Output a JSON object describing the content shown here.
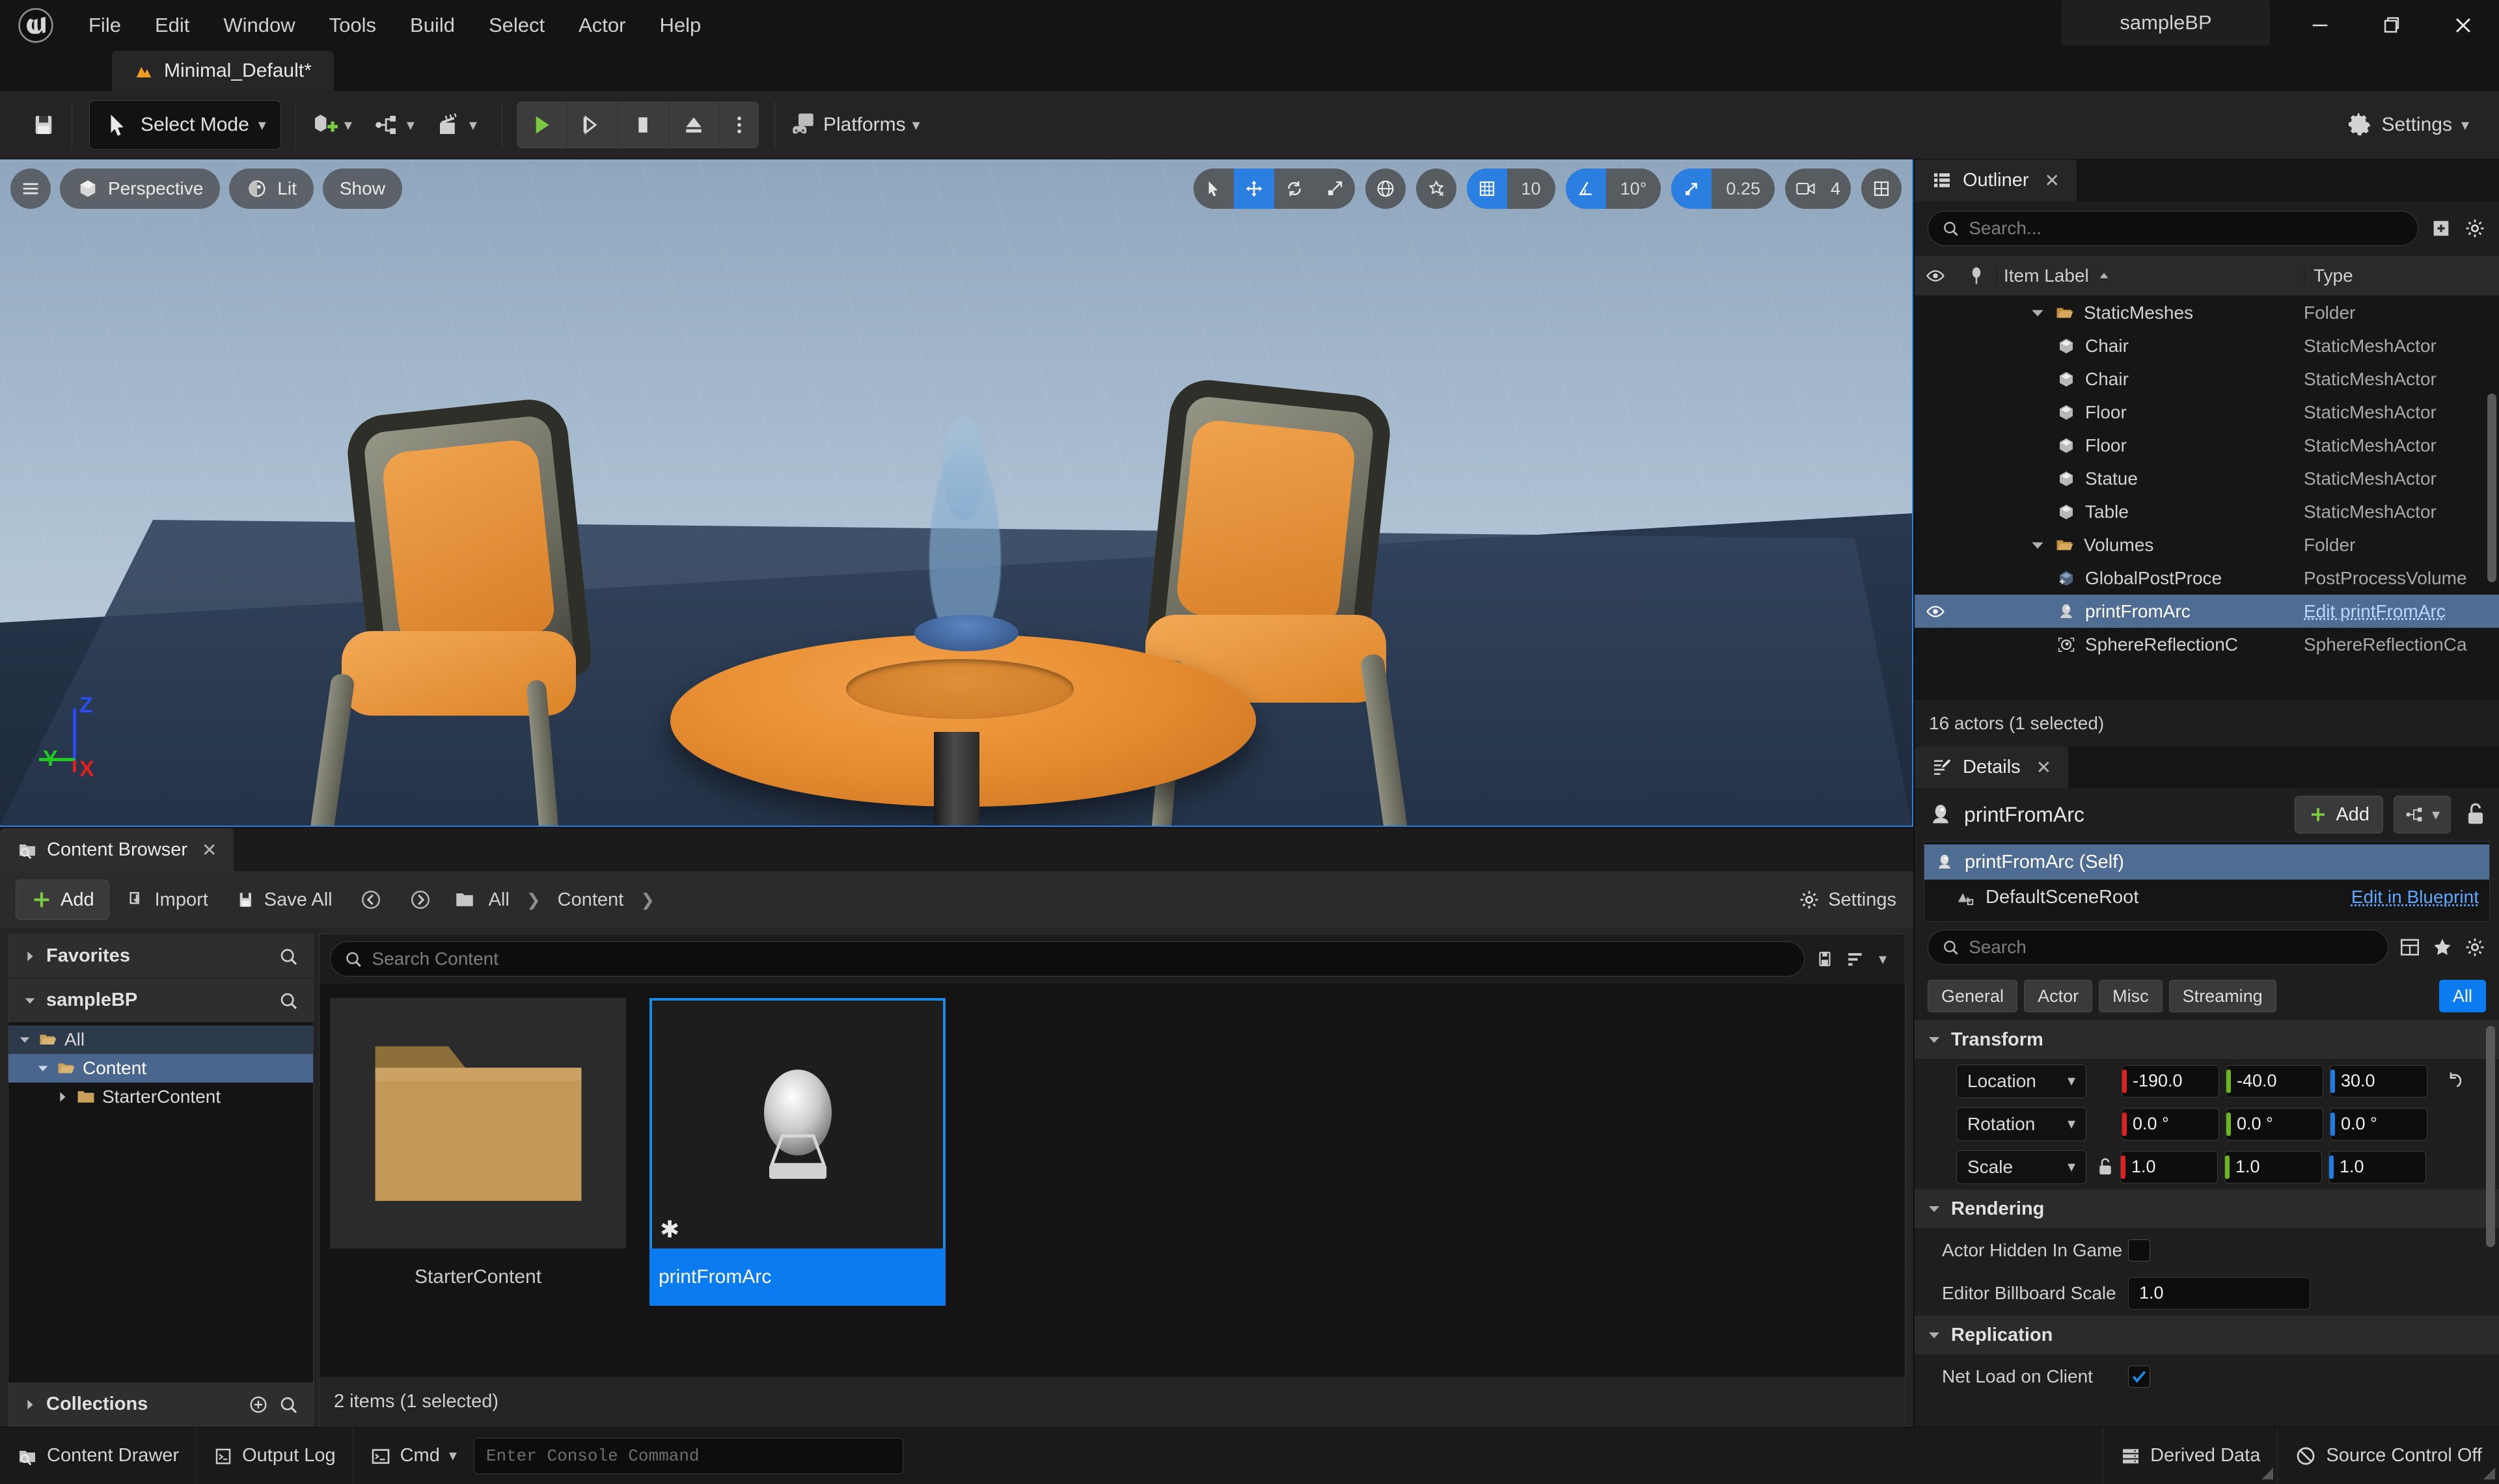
{
  "window": {
    "project_title": "sampleBP",
    "minimize": "minimize-icon",
    "maximize": "maximize-icon",
    "close": "close-icon"
  },
  "menubar": {
    "items": [
      "File",
      "Edit",
      "Window",
      "Tools",
      "Build",
      "Select",
      "Actor",
      "Help"
    ]
  },
  "level_tab": {
    "label": "Minimal_Default*"
  },
  "toolbar": {
    "save_icon": "save-icon",
    "select_mode": "Select Mode",
    "create_icon": "add-actor-icon",
    "blueprints_icon": "blueprints-icon",
    "cinematics_icon": "cinematics-icon",
    "play": "play-icon",
    "step": "skip-icon",
    "stop": "stop-icon",
    "eject": "eject-icon",
    "more": "more-options-icon",
    "platforms": "Platforms",
    "settings": "Settings"
  },
  "viewport": {
    "menu_icon": "viewport-menu-icon",
    "perspective": "Perspective",
    "lit": "Lit",
    "show": "Show",
    "transform_tools": [
      "select-icon",
      "move-icon",
      "rotate-icon",
      "scale-icon"
    ],
    "coordinate_system": "world-space-icon",
    "surface_snap": "surface-snap-icon",
    "grid_snap_enabled": true,
    "grid_snap_value": "10",
    "angle_snap_enabled": true,
    "angle_snap_value": "10°",
    "scale_snap_enabled": true,
    "scale_snap_value": "0.25",
    "camera_speed": "4",
    "layout_icon": "viewport-layout-icon",
    "axes": {
      "x": "X",
      "y": "Y",
      "z": "Z",
      "x_color": "#e02020",
      "y_color": "#1fc91f",
      "z_color": "#2a4bf0"
    }
  },
  "outliner": {
    "tab_label": "Outliner",
    "close": "close-icon",
    "search_placeholder": "Search...",
    "new_folder_icon": "new-folder-icon",
    "settings_icon": "gear-icon",
    "columns": {
      "visibility": "eye-icon",
      "pin": "pin-icon",
      "item_label": "Item Label",
      "sort": "sort-asc-icon",
      "type": "Type"
    },
    "rows": [
      {
        "label": "StaticMeshes",
        "type": "Folder",
        "icon": "folder-icon",
        "indent": 1,
        "expanded": true,
        "selected": false
      },
      {
        "label": "Chair",
        "type": "StaticMeshActor",
        "icon": "mesh-icon",
        "indent": 2,
        "selected": false
      },
      {
        "label": "Chair",
        "type": "StaticMeshActor",
        "icon": "mesh-icon",
        "indent": 2,
        "selected": false
      },
      {
        "label": "Floor",
        "type": "StaticMeshActor",
        "icon": "mesh-icon",
        "indent": 2,
        "selected": false
      },
      {
        "label": "Floor",
        "type": "StaticMeshActor",
        "icon": "mesh-icon",
        "indent": 2,
        "selected": false
      },
      {
        "label": "Statue",
        "type": "StaticMeshActor",
        "icon": "mesh-icon",
        "indent": 2,
        "selected": false
      },
      {
        "label": "Table",
        "type": "StaticMeshActor",
        "icon": "mesh-icon",
        "indent": 2,
        "selected": false
      },
      {
        "label": "Volumes",
        "type": "Folder",
        "icon": "folder-icon",
        "indent": 1,
        "expanded": true,
        "selected": false
      },
      {
        "label": "GlobalPostProce",
        "type": "PostProcessVolume",
        "icon": "volume-icon",
        "indent": 2,
        "selected": false
      },
      {
        "label": "printFromArc",
        "type": "Edit printFromArc",
        "icon": "blueprint-actor-icon",
        "indent": 2,
        "selected": true
      },
      {
        "label": "SphereReflectionC",
        "type": "SphereReflectionCa",
        "icon": "reflection-capture-icon",
        "indent": 2,
        "selected": false
      }
    ],
    "status": "16 actors (1 selected)"
  },
  "details": {
    "tab_label": "Details",
    "close": "close-icon",
    "actor_name": "printFromArc",
    "actor_icon": "blueprint-actor-icon",
    "add_label": "Add",
    "add_icon": "plus-icon",
    "hierarchy_icon": "blueprint-hierarchy-icon",
    "lock_icon": "unlock-icon",
    "components": [
      {
        "label": "printFromArc (Self)",
        "icon": "blueprint-actor-icon",
        "selected": true,
        "link": ""
      },
      {
        "label": "DefaultSceneRoot",
        "icon": "scene-root-icon",
        "selected": false,
        "link": "Edit in Blueprint"
      }
    ],
    "search_placeholder": "Search",
    "column_icon": "columns-icon",
    "favorite_icon": "star-icon",
    "settings_icon": "gear-icon",
    "filters": [
      {
        "label": "General",
        "active": false
      },
      {
        "label": "Actor",
        "active": false
      },
      {
        "label": "Misc",
        "active": false
      },
      {
        "label": "Streaming",
        "active": false
      },
      {
        "label": "All",
        "active": true
      }
    ],
    "sections": [
      {
        "name": "Transform",
        "rows": [
          {
            "kind": "vector",
            "label": "Location",
            "dropdown": true,
            "values": [
              "-190.0",
              "-40.0",
              "30.0"
            ],
            "reset": true,
            "lock": false
          },
          {
            "kind": "vector",
            "label": "Rotation",
            "dropdown": true,
            "values": [
              "0.0 °",
              "0.0 °",
              "0.0 °"
            ],
            "reset": false,
            "lock": false
          },
          {
            "kind": "vector",
            "label": "Scale",
            "dropdown": true,
            "values": [
              "1.0",
              "1.0",
              "1.0"
            ],
            "reset": false,
            "lock": true
          }
        ]
      },
      {
        "name": "Rendering",
        "rows": [
          {
            "kind": "checkbox",
            "label": "Actor Hidden In Game",
            "checked": false
          },
          {
            "kind": "number",
            "label": "Editor Billboard Scale",
            "value": "1.0"
          }
        ]
      },
      {
        "name": "Replication",
        "rows": [
          {
            "kind": "checkbox",
            "label": "Net Load on Client",
            "checked": true
          }
        ]
      }
    ],
    "axis_colors": {
      "x": "#e02020",
      "y": "#6db51f",
      "z": "#1f7be0"
    }
  },
  "content_browser": {
    "tab_label": "Content Browser",
    "close": "close-icon",
    "add_label": "Add",
    "import_label": "Import",
    "save_all_label": "Save All",
    "back_icon": "back-arrow-icon",
    "forward_icon": "forward-arrow-icon",
    "path_icon": "folder-icon",
    "breadcrumbs": [
      "All",
      "Content"
    ],
    "settings_label": "Settings",
    "sections": {
      "favorites": "Favorites",
      "project": "sampleBP",
      "collections": "Collections"
    },
    "tree": [
      {
        "label": "All",
        "indent": 0,
        "expanded": true,
        "state": "parent-selected"
      },
      {
        "label": "Content",
        "indent": 1,
        "expanded": true,
        "state": "selected"
      },
      {
        "label": "StarterContent",
        "indent": 2,
        "expanded": false,
        "state": "normal"
      }
    ],
    "search_placeholder": "Search Content",
    "save_icon": "save-icon",
    "filter_icon": "filter-icon",
    "assets": [
      {
        "name": "StarterContent",
        "kind": "folder",
        "selected": false,
        "dirty": false
      },
      {
        "name": "printFromArc",
        "kind": "blueprint",
        "selected": true,
        "dirty": true
      }
    ],
    "status": "2 items (1 selected)"
  },
  "statusbar": {
    "content_drawer": "Content Drawer",
    "output_log": "Output Log",
    "cmd_label": "Cmd",
    "console_placeholder": "Enter Console Command",
    "derived_data": "Derived Data",
    "source_control": "Source Control Off"
  },
  "colors": {
    "accent_blue": "#0b7cf0",
    "selection_blue": "#4f6c93",
    "viewport_border": "#2a7fe0",
    "green_play": "#7ac943",
    "folder_tan": "#c8a05a"
  }
}
